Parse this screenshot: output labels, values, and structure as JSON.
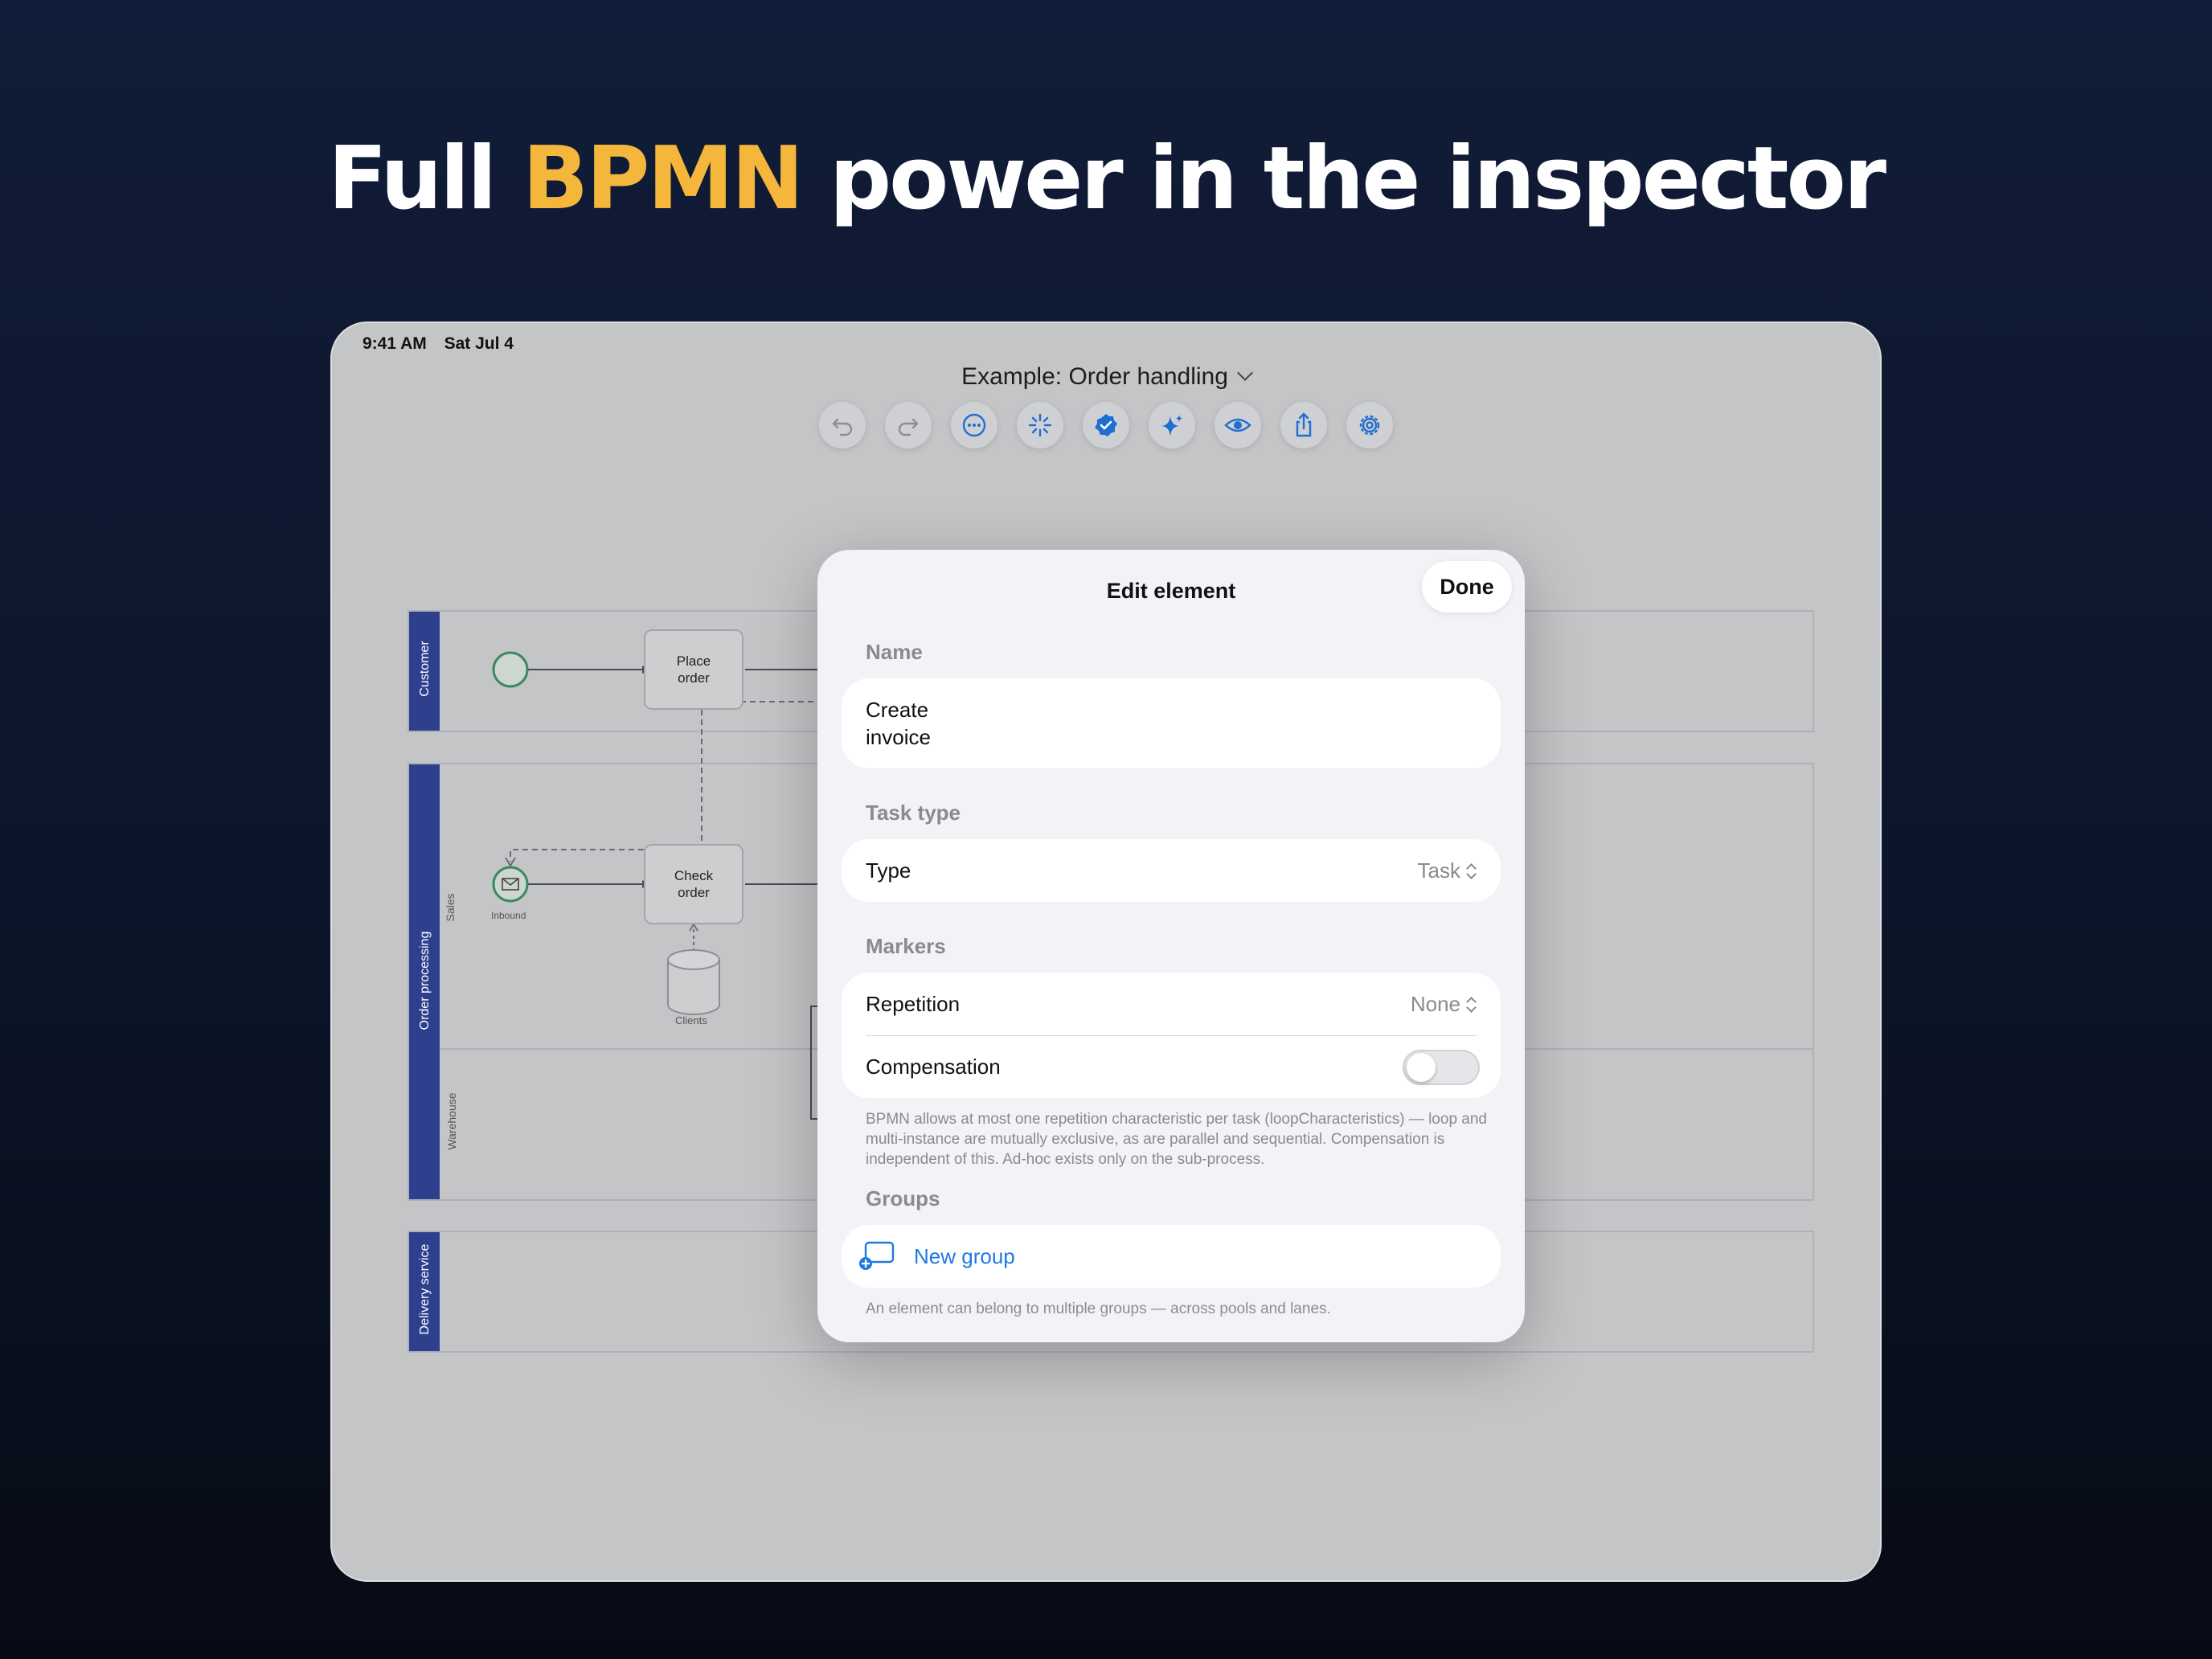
{
  "headline": {
    "before": "Full ",
    "accent": "BPMN",
    "after": " power in the inspector"
  },
  "colors": {
    "accent": "#f4b73c",
    "background": "#0f1a33",
    "link": "#1f7ae0",
    "pool_label": "#2e3f8e"
  },
  "status_bar": {
    "time": "9:41 AM",
    "date": "Sat Jul 4"
  },
  "document": {
    "title": "Example: Order handling"
  },
  "toolbar": [
    {
      "icon": "undo-icon"
    },
    {
      "icon": "redo-icon"
    },
    {
      "icon": "more-icon"
    },
    {
      "icon": "layout-icon"
    },
    {
      "icon": "validate-icon"
    },
    {
      "icon": "ai-sparkle-icon"
    },
    {
      "icon": "preview-icon"
    },
    {
      "icon": "share-icon"
    },
    {
      "icon": "settings-icon"
    }
  ],
  "diagram": {
    "pools": {
      "customer": "Customer",
      "order_processing": "Order processing",
      "delivery": "Delivery service"
    },
    "lanes": {
      "sales": "Sales",
      "warehouse": "Warehouse"
    },
    "tasks": {
      "place_order": "Place\norder",
      "check_order": "Check\norder"
    },
    "events": {
      "inbound": "Inbound"
    },
    "data_store": "Clients"
  },
  "sheet": {
    "title": "Edit element",
    "done_label": "Done",
    "name_header": "Name",
    "name_value": "Create\ninvoice",
    "task_type_header": "Task type",
    "type_label": "Type",
    "type_value": "Task",
    "markers_header": "Markers",
    "repetition_label": "Repetition",
    "repetition_value": "None",
    "compensation_label": "Compensation",
    "compensation_on": false,
    "markers_note": "BPMN allows at most one repetition characteristic per task (loopCharacteristics) — loop and multi-instance are mutually exclusive, as are parallel and sequential. Compensation is independent of this. Ad-hoc exists only on the sub-process.",
    "groups_header": "Groups",
    "new_group_label": "New group",
    "groups_note": "An element can belong to multiple groups — across pools and lanes."
  }
}
